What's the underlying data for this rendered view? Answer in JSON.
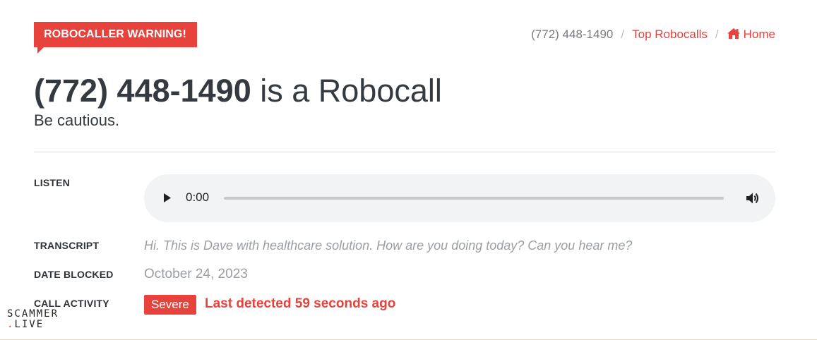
{
  "warning_tag": "ROBOCALLER WARNING!",
  "breadcrumb": {
    "current": "(772) 448-1490",
    "top_robocalls": "Top Robocalls",
    "home": "Home"
  },
  "heading": {
    "number": "(772) 448-1490",
    "suffix": "is a Robocall"
  },
  "subtitle": "Be cautious.",
  "details": {
    "listen_label": "LISTEN",
    "audio": {
      "time": "0:00",
      "progress": 0
    },
    "transcript_label": "TRANSCRIPT",
    "transcript": "Hi. This is Dave with healthcare solution. How are you doing today? Can you hear me?",
    "date_label": "DATE BLOCKED",
    "date": "October 24, 2023",
    "activity_label": "CALL ACTIVITY",
    "severity": "Severe",
    "last_detected": "Last detected 59 seconds ago"
  },
  "logo": {
    "line1": "SCAMMER",
    "line2": "LIVE"
  },
  "colors": {
    "accent": "#e8423c",
    "text": "#343a40",
    "muted": "#9a9ea3"
  },
  "icons": [
    "home-icon",
    "play-icon",
    "volume-icon"
  ]
}
